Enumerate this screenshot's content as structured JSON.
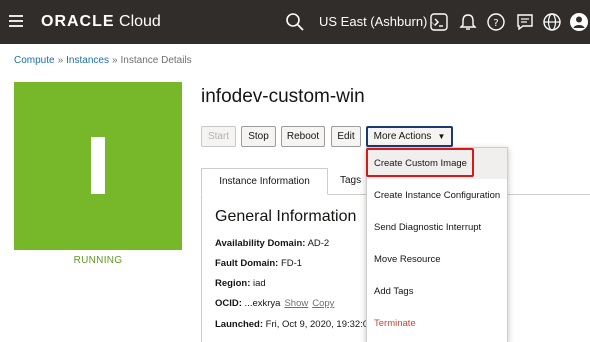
{
  "header": {
    "brand_strong": "ORACLE",
    "brand_light": " Cloud",
    "region": "US East (Ashburn)",
    "icons": [
      "menu-icon",
      "search-icon",
      "chevron-down-icon",
      "cloud-shell-icon",
      "announcements-icon",
      "help-icon",
      "feedback-icon",
      "language-icon",
      "profile-icon"
    ]
  },
  "breadcrumb": {
    "items": [
      "Compute",
      "Instances"
    ],
    "separator": "»",
    "current": "Instance Details"
  },
  "instance": {
    "name": "infodev-custom-win",
    "status": "RUNNING",
    "tile_color": "#76b82a",
    "status_color": "#5f9a1e"
  },
  "actions": {
    "start": "Start",
    "stop": "Stop",
    "reboot": "Reboot",
    "edit": "Edit",
    "more": "More Actions"
  },
  "tabs": [
    "Instance Information",
    "Tags"
  ],
  "info": {
    "section_title": "General Information",
    "availability_domain_label": "Availability Domain:",
    "availability_domain_value": " AD-2",
    "fault_domain_label": "Fault Domain:",
    "fault_domain_value": " FD-1",
    "region_label": "Region:",
    "region_value": " iad",
    "ocid_label": "OCID:",
    "ocid_value": " ...exkrya",
    "ocid_show": "Show",
    "ocid_copy": "Copy",
    "launched_label": "Launched:",
    "launched_value": " Fri, Oct 9, 2020, 19:32:0"
  },
  "menu": {
    "items": [
      "Create Custom Image",
      "Create Instance Configuration",
      "Send Diagnostic Interrupt",
      "Move Resource",
      "Add Tags",
      "Terminate"
    ],
    "highlight_color": "#d21a1a",
    "danger_color": "#c74634"
  }
}
